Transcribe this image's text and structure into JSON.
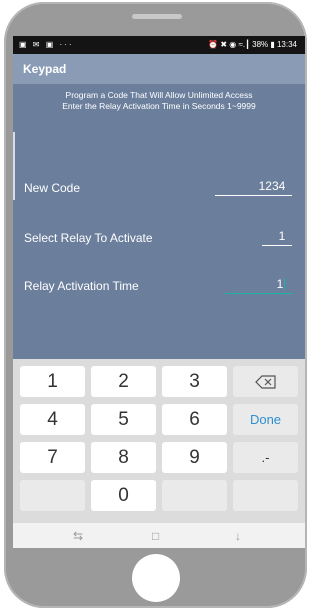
{
  "statusbar": {
    "left_icons": "▣ ✉ ▣ ···",
    "right": "⏰ ✖ ◉ ≈.┃ 38% ▮ 13:34"
  },
  "appbar": {
    "title": "Keypad"
  },
  "instructions": {
    "line1": "Program a Code That Will Allow Unlimited Access",
    "line2": "Enter the Relay Activation Time in Seconds 1~9999"
  },
  "form": {
    "new_code": {
      "label": "New Code",
      "value": "1234"
    },
    "relay": {
      "label": "Select Relay To Activate",
      "value": "1"
    },
    "time": {
      "label": "Relay Activation Time",
      "value": "1"
    }
  },
  "keypad": {
    "k1": "1",
    "k2": "2",
    "k3": "3",
    "k4": "4",
    "k5": "5",
    "k6": "6",
    "k7": "7",
    "k8": "8",
    "k9": "9",
    "k0": "0",
    "done": "Done",
    "dash": ".-",
    "backspace_icon": "backspace-icon"
  },
  "navbar": {
    "back_icon": "⇆",
    "recent_icon": "□",
    "down_icon": "↓"
  }
}
